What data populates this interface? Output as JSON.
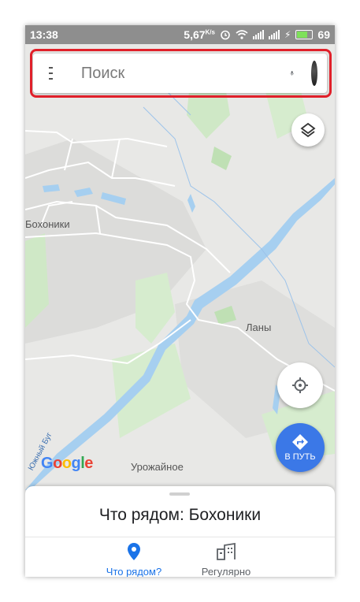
{
  "status_bar": {
    "time": "13:38",
    "speed": "5,67",
    "speed_unit": "K/s",
    "battery": "69"
  },
  "search": {
    "placeholder": "Поиск"
  },
  "map": {
    "labels": {
      "village_left": "Бохоники",
      "village_right": "Ланы",
      "village_bottom": "Урожайное",
      "river": "Южный Буг"
    },
    "logo": "Google"
  },
  "fab": {
    "go_label": "В ПУТЬ"
  },
  "sheet": {
    "title": "Что рядом: Бохоники",
    "tabs": [
      {
        "label": "Что рядом?",
        "active": true
      },
      {
        "label": "Регулярно",
        "active": false
      }
    ]
  },
  "colors": {
    "accent": "#1a73e8",
    "go_button": "#3b78e7",
    "highlight": "#e0202a",
    "water": "#a6cff0",
    "park": "#cfe8c6"
  },
  "icons": [
    "menu-icon",
    "microphone-icon",
    "avatar",
    "layers-icon",
    "my-location-icon",
    "directions-icon",
    "place-pin-icon",
    "commute-icon",
    "wifi-icon",
    "alarm-icon",
    "battery-icon"
  ]
}
